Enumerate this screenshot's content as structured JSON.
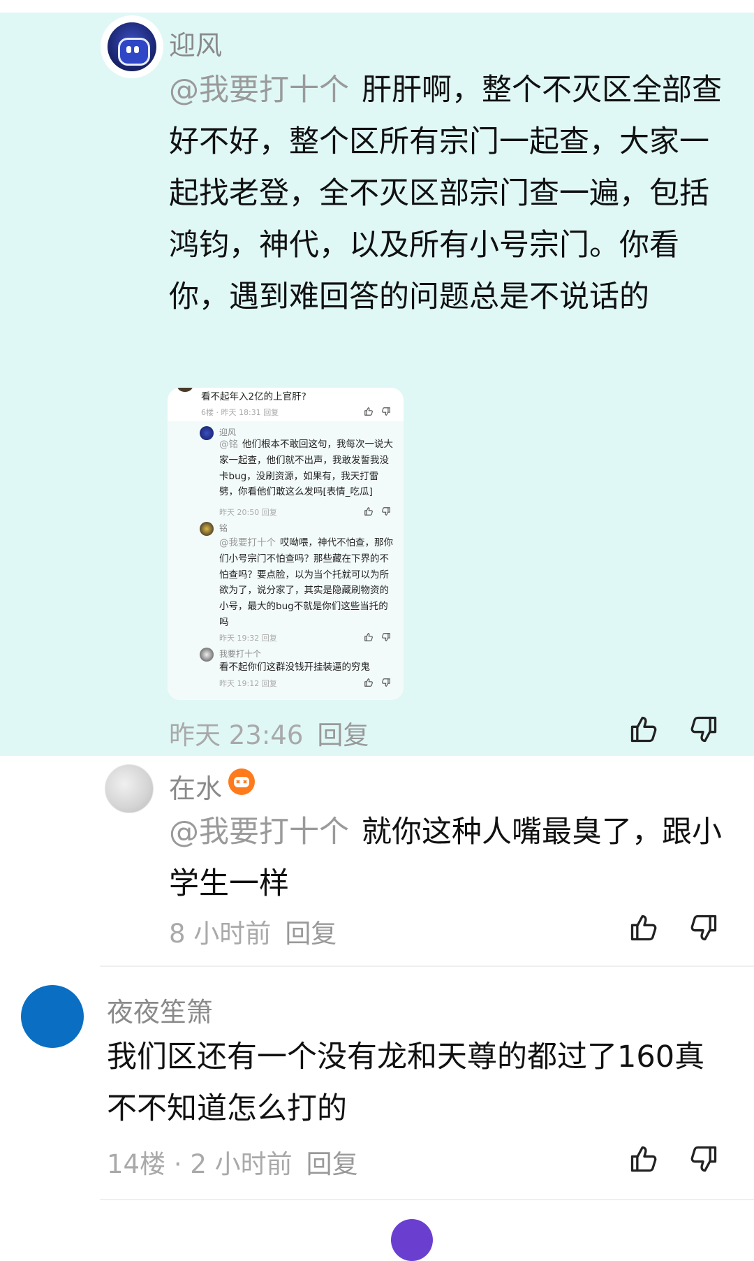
{
  "highlighted_reply": {
    "username": "迎风",
    "mention": "@我要打十个",
    "text": "肝肝啊，整个不灭区全部查好不好，整个区所有宗门一起查，大家一起找老登，全不灭区部宗门查一遍，包括鸿钧，神代，以及所有小号宗门。你看你，遇到难回答的问题总是不说话的",
    "time": "昨天 23:46",
    "reply_label": "回复",
    "background_color": "#dff8f6",
    "embedded_screenshot": {
      "top_comment": {
        "text": "看不起年入2亿的上官肝?",
        "meta": "6楼 · 昨天 18:31",
        "reply_label": "回复"
      },
      "replies": [
        {
          "username": "迎风",
          "mention": "@铭",
          "text": "他们根本不敢回这句，我每次一说大家一起查，他们就不出声，我敢发誓我没卡bug，没刷资源，如果有，我天打雷劈，你看他们敢这么发吗[表情_吃瓜]",
          "meta": "昨天 20:50",
          "reply_label": "回复"
        },
        {
          "username": "铭",
          "mention": "@我要打十个",
          "text": "哎呦喂，神代不怕查，那你们小号宗门不怕查吗？那些藏在下界的不怕查吗？要点脸，以为当个托就可以为所欲为了，说分家了，其实是隐藏刷物资的小号，最大的bug不就是你们这些当托的吗",
          "meta": "昨天 19:32",
          "reply_label": "回复"
        },
        {
          "username": "我要打十个",
          "mention": "",
          "text": "看不起你们这群没钱开挂装逼的穷鬼",
          "meta": "昨天 19:12",
          "reply_label": "回复"
        }
      ]
    }
  },
  "reply_zaishui": {
    "username": "在水",
    "mention": "@我要打十个",
    "text": "就你这种人嘴最臭了，跟小学生一样",
    "time": "8 小时前",
    "reply_label": "回复"
  },
  "comment_yeye": {
    "username": "夜夜笙箫",
    "text": "我们区还有一个没有龙和天尊的都过了160真不不知道怎么打的",
    "meta": "14楼 · 2 小时前",
    "reply_label": "回复"
  },
  "icons": {
    "like": "thumbs-up-icon",
    "dislike": "thumbs-down-icon",
    "badge": "game-badge-icon"
  }
}
